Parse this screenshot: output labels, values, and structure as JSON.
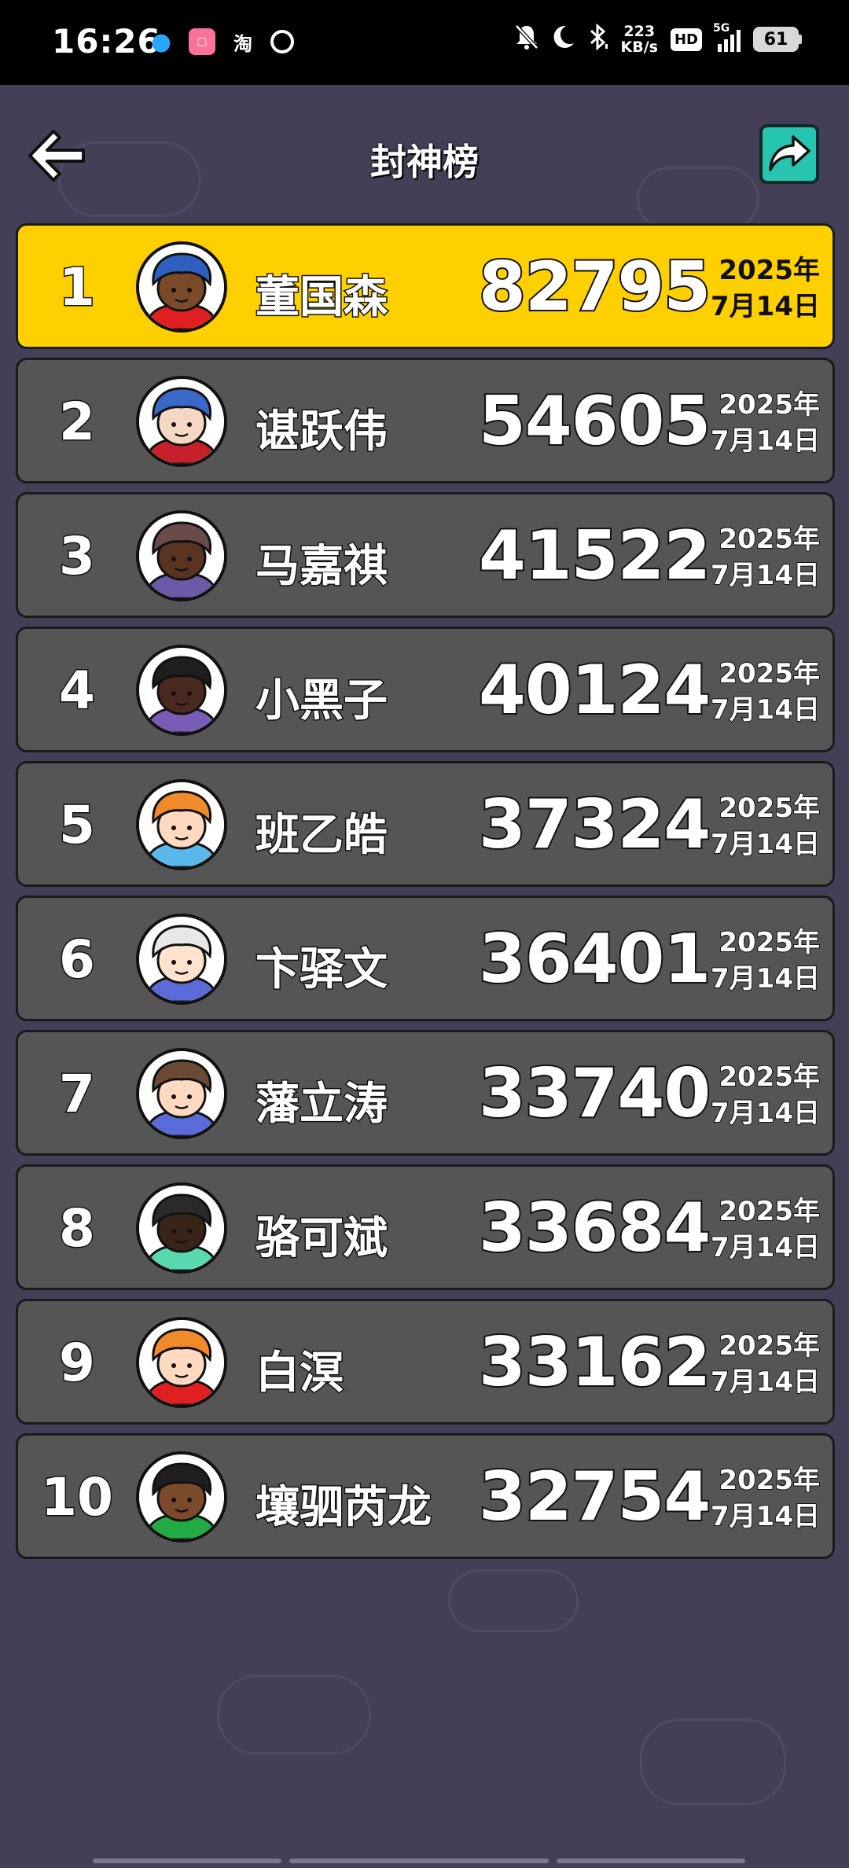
{
  "status_bar": {
    "time": "16:26",
    "net_speed_value": "223",
    "net_speed_unit": "KB/s",
    "hd_label": "HD",
    "network_label": "5G",
    "battery": "61",
    "app_icons": [
      "qq-icon",
      "bilibili-icon",
      "taobao-icon",
      "loop-icon"
    ],
    "status_icons": [
      "mute-bell-icon",
      "moon-icon",
      "bluetooth-icon"
    ]
  },
  "header": {
    "title": "封神榜",
    "back_icon": "arrow-left-icon",
    "share_icon": "share-arrow-icon"
  },
  "colors": {
    "background": "#423f56",
    "row_default": "#555555",
    "row_highlight": "#ffd000",
    "share_button": "#27c4b0"
  },
  "leaderboard": [
    {
      "rank": "1",
      "name": "董国森",
      "score": "82795",
      "date_year": "2025年",
      "date_day": "7月14日",
      "hair": "#2f5fbf",
      "skin": "#7a4a2a",
      "shirt": "#e02020"
    },
    {
      "rank": "2",
      "name": "谌跃伟",
      "score": "54605",
      "date_year": "2025年",
      "date_day": "7月14日",
      "hair": "#3a68c8",
      "skin": "#f6d7c3",
      "shirt": "#c8202a"
    },
    {
      "rank": "3",
      "name": "马嘉祺",
      "score": "41522",
      "date_year": "2025年",
      "date_day": "7月14日",
      "hair": "#6b4a4a",
      "skin": "#5a3320",
      "shirt": "#6a5aa8"
    },
    {
      "rank": "4",
      "name": "小黑子",
      "score": "40124",
      "date_year": "2025年",
      "date_day": "7月14日",
      "hair": "#1e1e1e",
      "skin": "#4a2a20",
      "shirt": "#7a5cb8"
    },
    {
      "rank": "5",
      "name": "班乙皓",
      "score": "37324",
      "date_year": "2025年",
      "date_day": "7月14日",
      "hair": "#f08a2a",
      "skin": "#ffd9c0",
      "shirt": "#5ab8ea"
    },
    {
      "rank": "6",
      "name": "卞驿文",
      "score": "36401",
      "date_year": "2025年",
      "date_day": "7月14日",
      "hair": "#e8e8e8",
      "skin": "#ffe3cf",
      "shirt": "#5a6ad8"
    },
    {
      "rank": "7",
      "name": "藩立涛",
      "score": "33740",
      "date_year": "2025年",
      "date_day": "7月14日",
      "hair": "#6b4a35",
      "skin": "#ffd9c0",
      "shirt": "#5a6ad8"
    },
    {
      "rank": "8",
      "name": "骆可斌",
      "score": "33684",
      "date_year": "2025年",
      "date_day": "7月14日",
      "hair": "#2a2a2a",
      "skin": "#3a2418",
      "shirt": "#5ad8b0"
    },
    {
      "rank": "9",
      "name": "白溟",
      "score": "33162",
      "date_year": "2025年",
      "date_day": "7月14日",
      "hair": "#f08a2a",
      "skin": "#ffd9c0",
      "shirt": "#e02020"
    },
    {
      "rank": "10",
      "name": "壤驷芮龙",
      "score": "32754",
      "date_year": "2025年",
      "date_day": "7月14日",
      "hair": "#1e1e1e",
      "skin": "#7a4a2a",
      "shirt": "#22aa44"
    }
  ]
}
